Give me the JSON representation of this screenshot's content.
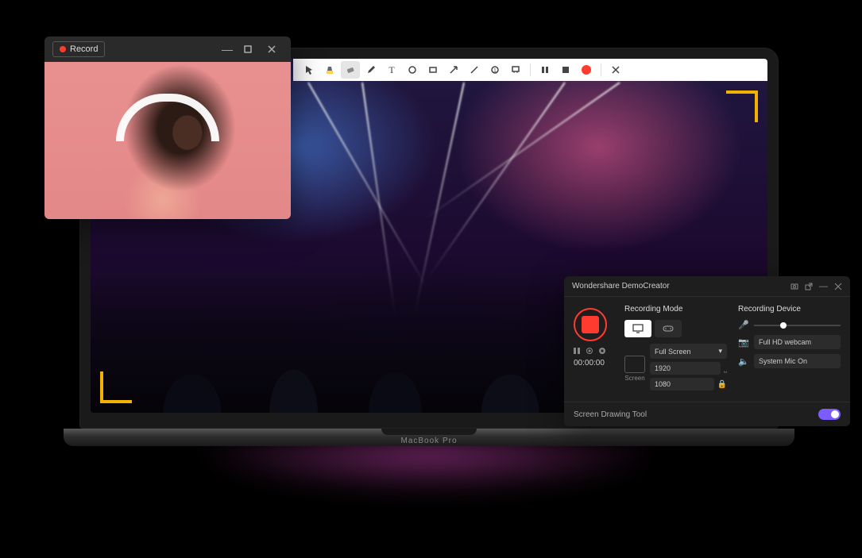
{
  "laptop": {
    "label": "MacBook Pro"
  },
  "record_window": {
    "button_label": "Record",
    "controls": {
      "minimize": "minimize",
      "maximize": "maximize",
      "close": "close"
    }
  },
  "annotation_toolbar": {
    "tools": [
      "cursor",
      "highlighter",
      "eraser",
      "pen",
      "text",
      "circle",
      "rectangle",
      "arrow",
      "line",
      "step",
      "whiteboard",
      "pause",
      "stop",
      "record",
      "close"
    ]
  },
  "democreator": {
    "title": "Wondershare DemoCreator",
    "window_buttons": [
      "capture",
      "popout",
      "minimize",
      "close"
    ],
    "section_mode": "Recording Mode",
    "section_device": "Recording Device",
    "mode_tabs": [
      "screen",
      "game"
    ],
    "transport": [
      "pause",
      "record-small",
      "stop"
    ],
    "timer": "00:00:00",
    "screen_label": "Screen",
    "capture_area": {
      "preset": "Full Screen",
      "width": "1920",
      "height": "1080",
      "locked": true
    },
    "devices": {
      "mic": {
        "level": 30
      },
      "webcam": "Full HD webcam",
      "audio": "System Mic On"
    },
    "footer": {
      "drawing_label": "Screen Drawing Tool",
      "drawing_on": true
    }
  }
}
